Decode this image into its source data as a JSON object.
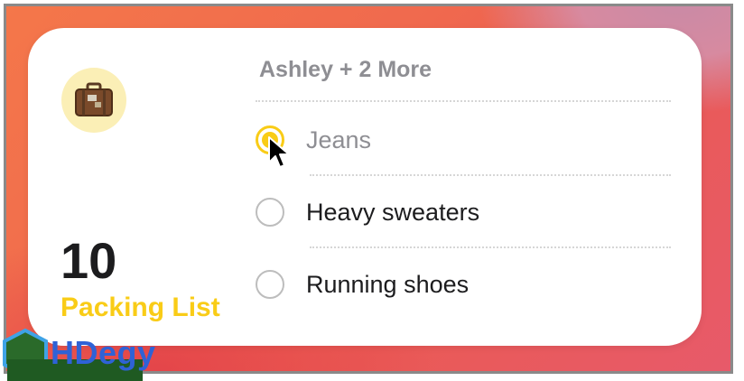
{
  "widget": {
    "icon": "suitcase-icon",
    "count": "10",
    "list_name": "Packing List",
    "shared_with": "Ashley + 2 More",
    "items": [
      {
        "label": "Jeans",
        "checked": true
      },
      {
        "label": "Heavy sweaters",
        "checked": false
      },
      {
        "label": "Running shoes",
        "checked": false
      }
    ]
  },
  "watermark": {
    "text": "HDegy"
  },
  "colors": {
    "accent": "#f9cc17",
    "count": "#1c1c1e",
    "muted": "#8e8e93",
    "watermark": "#2f62d6"
  }
}
